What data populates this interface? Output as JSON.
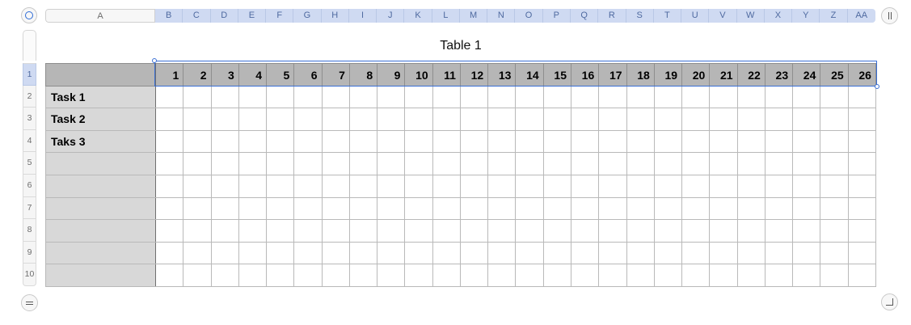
{
  "table": {
    "title": "Table 1",
    "column_headers": [
      "A",
      "B",
      "C",
      "D",
      "E",
      "F",
      "G",
      "H",
      "I",
      "J",
      "K",
      "L",
      "M",
      "N",
      "O",
      "P",
      "Q",
      "R",
      "S",
      "T",
      "U",
      "V",
      "W",
      "X",
      "Y",
      "Z",
      "AA"
    ],
    "row_headers": [
      "1",
      "2",
      "3",
      "4",
      "5",
      "6",
      "7",
      "8",
      "9",
      "10"
    ],
    "header_row": [
      "1",
      "2",
      "3",
      "4",
      "5",
      "6",
      "7",
      "8",
      "9",
      "10",
      "11",
      "12",
      "13",
      "14",
      "15",
      "16",
      "17",
      "18",
      "19",
      "20",
      "21",
      "22",
      "23",
      "24",
      "25",
      "26"
    ],
    "row_labels": [
      "",
      "Task 1",
      "Task 2",
      "Taks 3",
      "",
      "",
      "",
      "",
      "",
      ""
    ],
    "selected_row": "1",
    "selected_columns": [
      "B",
      "C",
      "D",
      "E",
      "F",
      "G",
      "H",
      "I",
      "J",
      "K",
      "L",
      "M",
      "N",
      "O",
      "P",
      "Q",
      "R",
      "S",
      "T",
      "U",
      "V",
      "W",
      "X",
      "Y",
      "Z",
      "AA"
    ]
  },
  "colors": {
    "selection": "#3a6fd4",
    "header_row_fill": "#b6b6b6",
    "label_column_fill": "#d8d8d8",
    "header_highlight": "#cfdaf2"
  },
  "icons": {
    "select_all": "circle-select-icon",
    "pause_toggle": "pause-icon",
    "add_row": "add-row-icon",
    "resize": "resize-corner-icon"
  }
}
